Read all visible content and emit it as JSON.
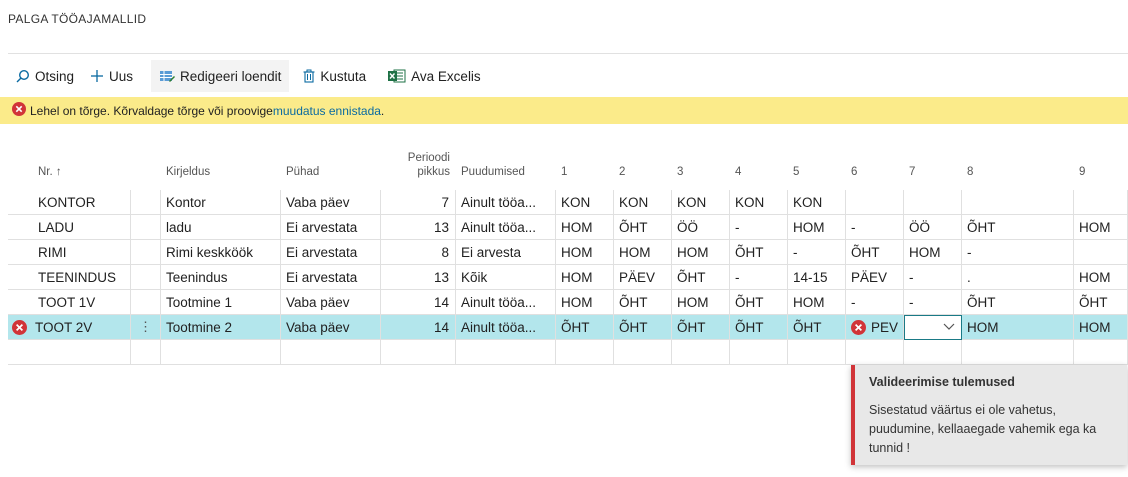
{
  "page": {
    "title": "PALGA TÖÖAJAMALLID"
  },
  "actions": {
    "search": "Otsing",
    "new": "Uus",
    "edit_list": "Redigeeri loendit",
    "delete": "Kustuta",
    "open_excel": "Ava Excelis"
  },
  "error_bar": {
    "text": "Lehel on tõrge. Kõrvaldage tõrge või proovige ",
    "link": "muudatus ennistada",
    "suffix": "."
  },
  "columns": {
    "nr": "Nr. ↑",
    "description": "Kirjeldus",
    "holidays": "Pühad",
    "period_line1": "Perioodi",
    "period_line2": "pikkus",
    "absences": "Puudumised",
    "d1": "1",
    "d2": "2",
    "d3": "3",
    "d4": "4",
    "d5": "5",
    "d6": "6",
    "d7": "7",
    "d8": "8",
    "d9": "9"
  },
  "rows": [
    {
      "nr": "KONTOR",
      "desc": "Kontor",
      "holidays": "Vaba päev",
      "period": "7",
      "absences": "Ainult tööa...",
      "d1": "KON",
      "d2": "KON",
      "d3": "KON",
      "d4": "KON",
      "d5": "KON",
      "d6": "",
      "d7": "",
      "d8": "",
      "d9": ""
    },
    {
      "nr": "LADU",
      "desc": "ladu",
      "holidays": "Ei arvestata",
      "period": "13",
      "absences": "Ainult tööa...",
      "d1": "HOM",
      "d2": "ÕHT",
      "d3": "ÖÖ",
      "d4": "-",
      "d5": "HOM",
      "d6": "-",
      "d7": "ÖÖ",
      "d8": "ÕHT",
      "d9": "HOM"
    },
    {
      "nr": "RIMI",
      "desc": "Rimi keskköök",
      "holidays": "Ei arvestata",
      "period": "8",
      "absences": "Ei arvesta",
      "d1": "HOM",
      "d2": "HOM",
      "d3": "HOM",
      "d4": "ÕHT",
      "d5": "-",
      "d6": "ÕHT",
      "d7": "HOM",
      "d8": "-",
      "d9": ""
    },
    {
      "nr": "TEENINDUS",
      "desc": "Teenindus",
      "holidays": "Ei arvestata",
      "period": "13",
      "absences": "Kõik",
      "d1": "HOM",
      "d2": "PÄEV",
      "d3": "ÕHT",
      "d4": "-",
      "d5": "14-15",
      "d6": "PÄEV",
      "d7": "-",
      "d8": ".",
      "d9": "HOM"
    },
    {
      "nr": "TOOT 1V",
      "desc": "Tootmine 1",
      "holidays": "Vaba päev",
      "period": "14",
      "absences": "Ainult tööa...",
      "d1": "HOM",
      "d2": "ÕHT",
      "d3": "HOM",
      "d4": "ÕHT",
      "d5": "HOM",
      "d6": "-",
      "d7": "-",
      "d8": "ÕHT",
      "d9": "ÕHT"
    },
    {
      "nr": "TOOT 2V",
      "desc": "Tootmine 2",
      "holidays": "Vaba päev",
      "period": "14",
      "absences": "Ainult tööa...",
      "d1": "ÕHT",
      "d2": "ÕHT",
      "d3": "ÕHT",
      "d4": "ÕHT",
      "d5": "ÕHT",
      "d6": "PEV",
      "d7": "",
      "d8": "HOM",
      "d9": "HOM"
    }
  ],
  "popup": {
    "title": "Valideerimise tulemused",
    "body": "Sisestatud väärtus ei ole vahetus, puudumine, kellaaegade vahemik ega ka tunnid !"
  },
  "colors": {
    "error": "#d13438",
    "warning_bg": "#fbeb8a",
    "active_row": "#b3e6ec",
    "link": "#0a6aa1"
  }
}
